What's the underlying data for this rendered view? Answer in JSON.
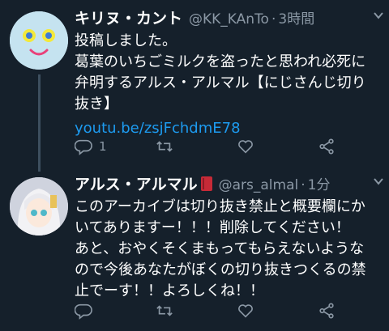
{
  "tweets": [
    {
      "display_name": "キリヌ・カント",
      "handle": "@KK_KAnTo",
      "time": "3時間",
      "body_lines": [
        "投稿しました。",
        "葛葉のいちごミルクを盗ったと思われ必死に",
        "弁明するアルス・アルマル【にじさんじ切り",
        "抜き】"
      ],
      "link": "youtu.be/zsjFchdmE78",
      "reply_count": "1",
      "icons": [
        "reply-icon",
        "retweet-icon",
        "like-icon",
        "share-icon"
      ]
    },
    {
      "display_name": "アルス・アルマル",
      "badge_icon": "red-book-emoji",
      "handle": "@ars_almal",
      "time": "1分",
      "body_lines": [
        "このアーカイブは切り抜き禁止と概要欄にか",
        "いてありますー！！！削除してください！",
        "あと、おやくそくまもってもらえないような",
        "ので今後あなたがぼくの切り抜きつくるの禁",
        "止でーす！！よろしくね！！"
      ],
      "icons": [
        "reply-icon",
        "retweet-icon",
        "like-icon",
        "share-icon"
      ]
    }
  ],
  "colors": {
    "background": "#15202b",
    "secondary_text": "#8b98a5",
    "link": "#1d9bf0",
    "thread_line": "#3d4f5f"
  }
}
